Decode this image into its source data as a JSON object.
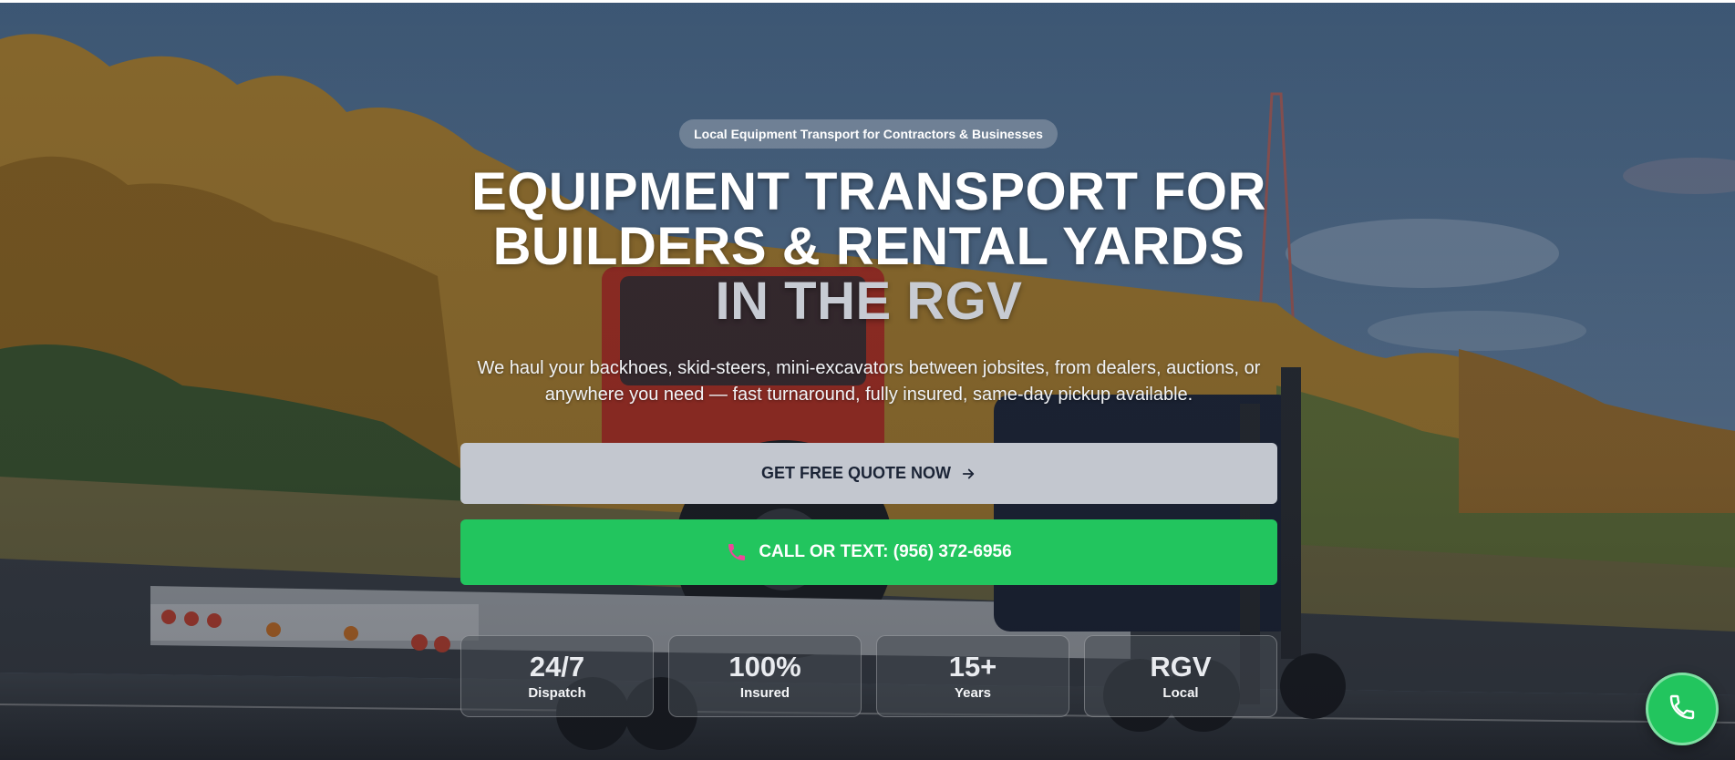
{
  "hero": {
    "badge": "Local Equipment Transport for Contractors & Businesses",
    "headline_main": "EQUIPMENT TRANSPORT FOR BUILDERS & RENTAL YARDS",
    "headline_accent": "IN THE RGV",
    "subtitle": "We haul your backhoes, skid-steers, mini-excavators between jobsites, from dealers, auctions, or anywhere you need — fast turnaround, fully insured, same-day pickup available."
  },
  "buttons": {
    "quote_label": "GET FREE QUOTE NOW",
    "quote_icon": "arrow-right-icon",
    "call_label": "CALL OR TEXT: (956) 372-6956",
    "call_icon": "phone-icon"
  },
  "stats": [
    {
      "value": "24/7",
      "label": "Dispatch"
    },
    {
      "value": "100%",
      "label": "Insured"
    },
    {
      "value": "15+",
      "label": "Years"
    },
    {
      "value": "RGV",
      "label": "Local"
    }
  ],
  "floating_button": {
    "icon": "phone-icon"
  },
  "colors": {
    "accent_green": "#22c55e",
    "quote_button_bg": "#c3c7cf",
    "headline_accent": "#c7cbd3",
    "phone_icon_pink": "#ec4899"
  },
  "background_image": "flatbed-truck-hauling-red-tractor-autumn-forest"
}
